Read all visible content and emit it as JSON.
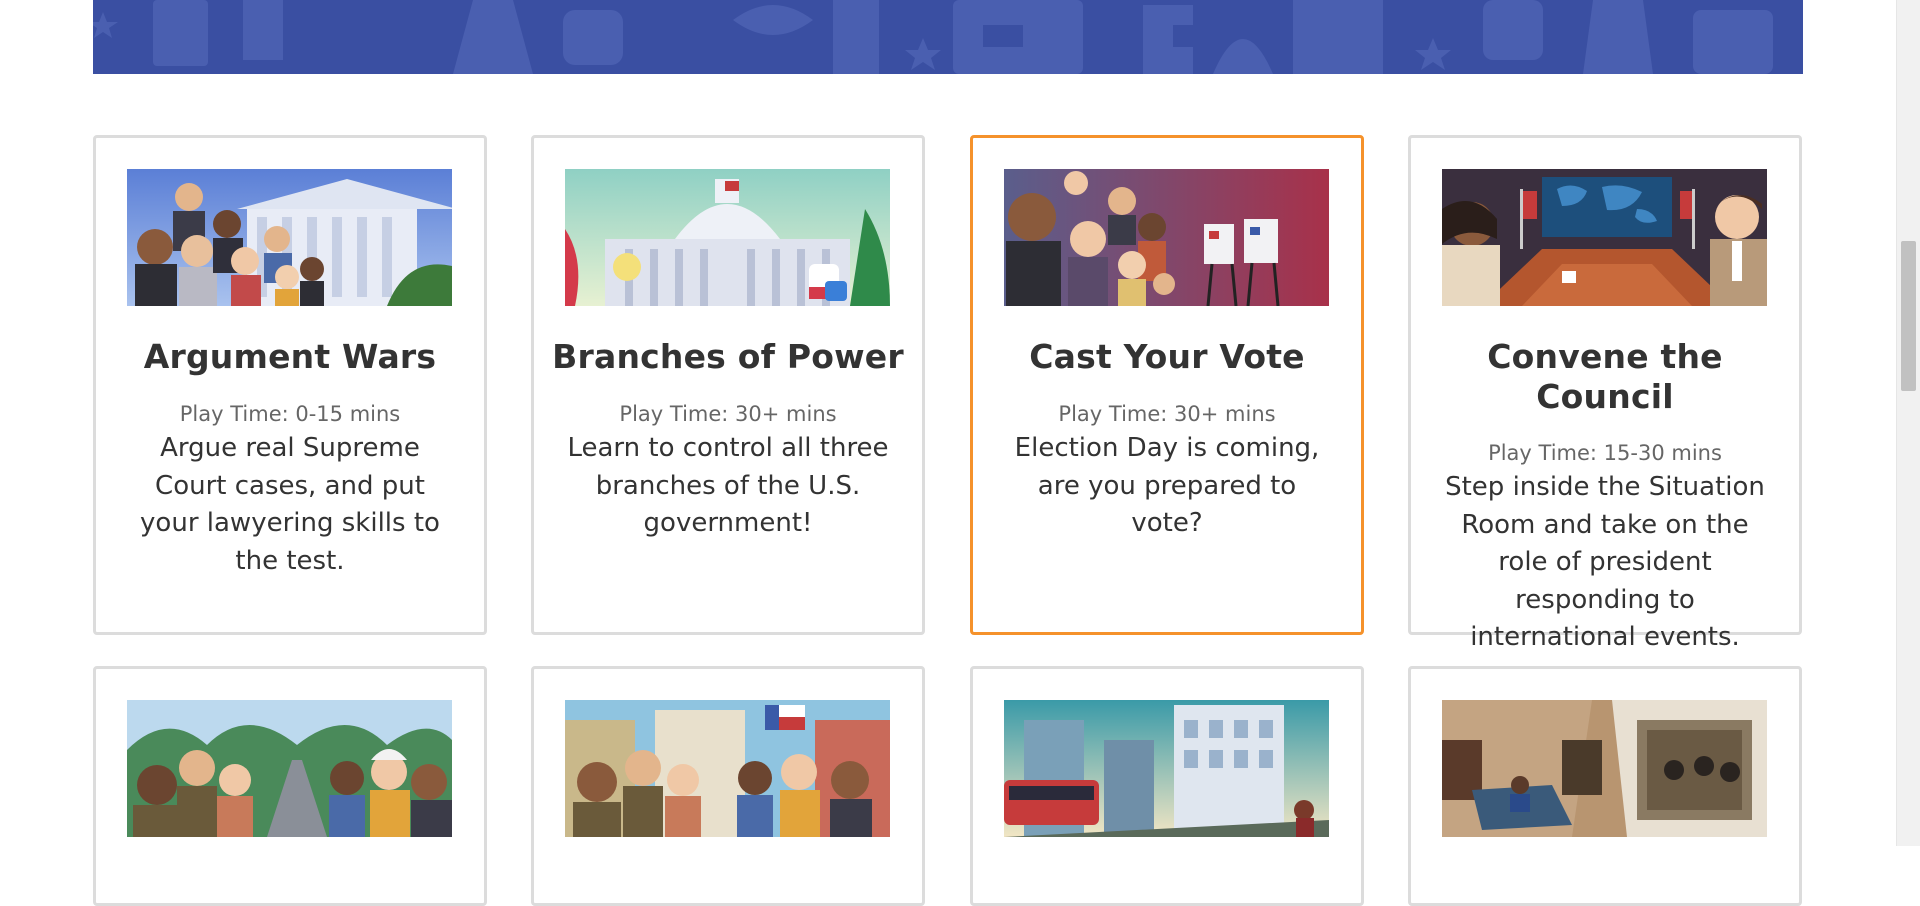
{
  "colors": {
    "banner": "#3a4fa2",
    "active_border": "#f5922b",
    "card_border": "#dcdcdc",
    "title_text": "#333333",
    "meta_text": "#666666"
  },
  "games": [
    {
      "title": "Argument Wars",
      "play_time": "Play Time: 0-15 mins",
      "description": "Argue real Supreme Court cases, and put your lawyering skills to the test."
    },
    {
      "title": "Branches of Power",
      "play_time": "Play Time: 30+ mins",
      "description": "Learn to control all three branches of the U.S. government!"
    },
    {
      "title": "Cast Your Vote",
      "play_time": "Play Time: 30+ mins",
      "description": "Election Day is coming, are you prepared to vote?"
    },
    {
      "title": "Convene the Council",
      "play_time": "Play Time: 15-30 mins",
      "description": "Step inside the Situation Room and take on the role of president responding to international events."
    }
  ]
}
